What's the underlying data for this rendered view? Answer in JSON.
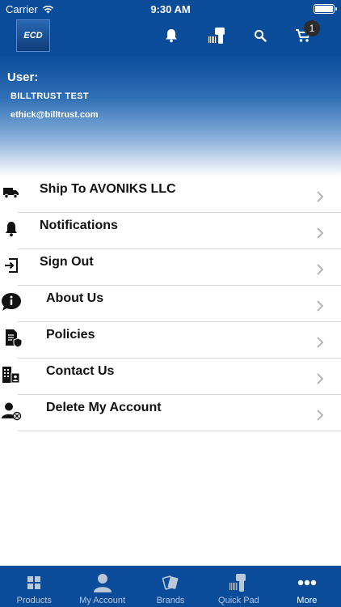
{
  "status": {
    "carrier": "Carrier",
    "time": "9:30 AM"
  },
  "navbar": {
    "logo_text": "ECD",
    "cart_count": "1"
  },
  "user": {
    "label": "User:",
    "name": "BILLTRUST TEST",
    "email": "ethick@billtrust.com"
  },
  "menu": [
    {
      "label": "Ship To AVONIKS LLC",
      "icon": "truck-icon"
    },
    {
      "label": "Notifications",
      "icon": "bell-icon"
    },
    {
      "label": "Sign Out",
      "icon": "sign-out-icon"
    },
    {
      "label": "About Us",
      "icon": "info-bubble-icon"
    },
    {
      "label": "Policies",
      "icon": "policy-document-icon"
    },
    {
      "label": "Contact Us",
      "icon": "building-contact-icon"
    },
    {
      "label": "Delete My Account",
      "icon": "delete-user-icon"
    }
  ],
  "tabs": [
    {
      "label": "Products",
      "icon": "grid-icon"
    },
    {
      "label": "My Account",
      "icon": "person-icon"
    },
    {
      "label": "Brands",
      "icon": "brands-icon"
    },
    {
      "label": "Quick Pad",
      "icon": "scanner-icon"
    },
    {
      "label": "More",
      "icon": "more-dots-icon"
    }
  ],
  "colors": {
    "primary": "#0a4c9a",
    "tab_inactive": "#b9c7d9",
    "divider": "#d8d8d8"
  }
}
